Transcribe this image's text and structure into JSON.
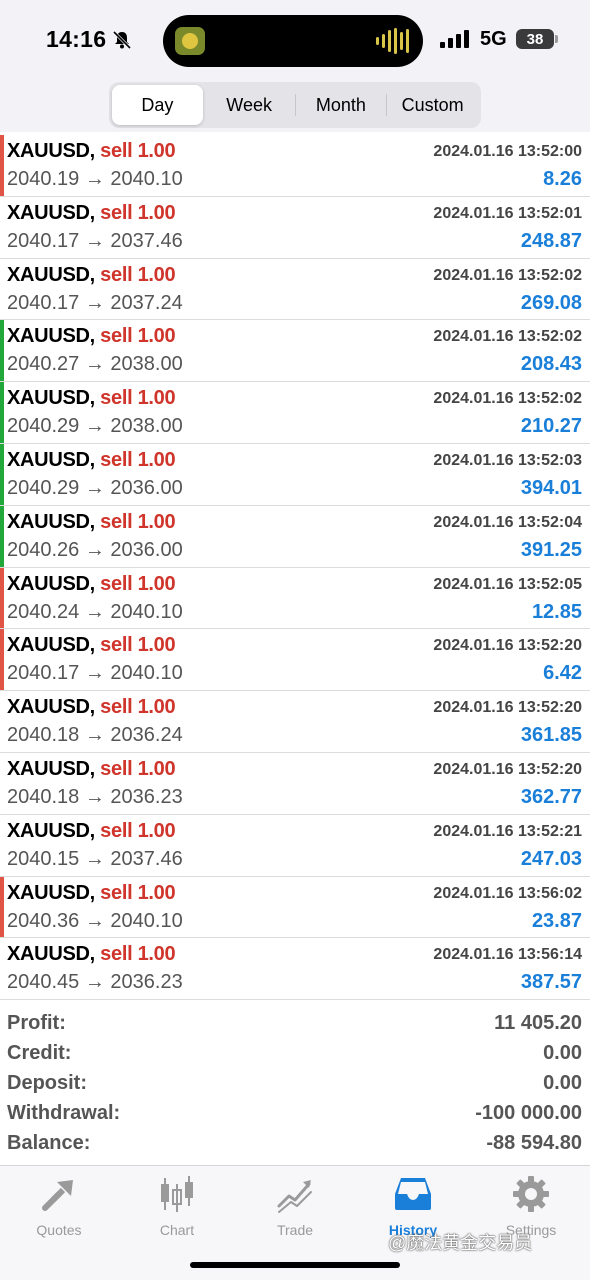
{
  "status_bar": {
    "time": "14:16",
    "network": "5G",
    "battery": "38"
  },
  "periods": {
    "tabs": [
      "Day",
      "Week",
      "Month",
      "Custom"
    ],
    "active": "Day"
  },
  "colors": {
    "sell": "#d0352b",
    "profit": "#1a7fd9",
    "marker_red": "#e05545",
    "marker_green": "#22a83a",
    "active_tab": "#1a7fd9"
  },
  "trades": [
    {
      "symbol": "XAUUSD",
      "side": "sell 1.00",
      "datetime": "2024.01.16 13:52:00",
      "open": "2040.19",
      "close": "2040.10",
      "profit": "8.26",
      "marker": "red"
    },
    {
      "symbol": "XAUUSD",
      "side": "sell 1.00",
      "datetime": "2024.01.16 13:52:01",
      "open": "2040.17",
      "close": "2037.46",
      "profit": "248.87",
      "marker": "none"
    },
    {
      "symbol": "XAUUSD",
      "side": "sell 1.00",
      "datetime": "2024.01.16 13:52:02",
      "open": "2040.17",
      "close": "2037.24",
      "profit": "269.08",
      "marker": "none"
    },
    {
      "symbol": "XAUUSD",
      "side": "sell 1.00",
      "datetime": "2024.01.16 13:52:02",
      "open": "2040.27",
      "close": "2038.00",
      "profit": "208.43",
      "marker": "green"
    },
    {
      "symbol": "XAUUSD",
      "side": "sell 1.00",
      "datetime": "2024.01.16 13:52:02",
      "open": "2040.29",
      "close": "2038.00",
      "profit": "210.27",
      "marker": "green"
    },
    {
      "symbol": "XAUUSD",
      "side": "sell 1.00",
      "datetime": "2024.01.16 13:52:03",
      "open": "2040.29",
      "close": "2036.00",
      "profit": "394.01",
      "marker": "green"
    },
    {
      "symbol": "XAUUSD",
      "side": "sell 1.00",
      "datetime": "2024.01.16 13:52:04",
      "open": "2040.26",
      "close": "2036.00",
      "profit": "391.25",
      "marker": "green"
    },
    {
      "symbol": "XAUUSD",
      "side": "sell 1.00",
      "datetime": "2024.01.16 13:52:05",
      "open": "2040.24",
      "close": "2040.10",
      "profit": "12.85",
      "marker": "red"
    },
    {
      "symbol": "XAUUSD",
      "side": "sell 1.00",
      "datetime": "2024.01.16 13:52:20",
      "open": "2040.17",
      "close": "2040.10",
      "profit": "6.42",
      "marker": "red"
    },
    {
      "symbol": "XAUUSD",
      "side": "sell 1.00",
      "datetime": "2024.01.16 13:52:20",
      "open": "2040.18",
      "close": "2036.24",
      "profit": "361.85",
      "marker": "none"
    },
    {
      "symbol": "XAUUSD",
      "side": "sell 1.00",
      "datetime": "2024.01.16 13:52:20",
      "open": "2040.18",
      "close": "2036.23",
      "profit": "362.77",
      "marker": "none"
    },
    {
      "symbol": "XAUUSD",
      "side": "sell 1.00",
      "datetime": "2024.01.16 13:52:21",
      "open": "2040.15",
      "close": "2037.46",
      "profit": "247.03",
      "marker": "none"
    },
    {
      "symbol": "XAUUSD",
      "side": "sell 1.00",
      "datetime": "2024.01.16 13:56:02",
      "open": "2040.36",
      "close": "2040.10",
      "profit": "23.87",
      "marker": "red"
    },
    {
      "symbol": "XAUUSD",
      "side": "sell 1.00",
      "datetime": "2024.01.16 13:56:14",
      "open": "2040.45",
      "close": "2036.23",
      "profit": "387.57",
      "marker": "none"
    }
  ],
  "arrow": "→",
  "summary": [
    {
      "label": "Profit:",
      "value": "11 405.20"
    },
    {
      "label": "Credit:",
      "value": "0.00"
    },
    {
      "label": "Deposit:",
      "value": "0.00"
    },
    {
      "label": "Withdrawal:",
      "value": "-100 000.00"
    },
    {
      "label": "Balance:",
      "value": "-88 594.80"
    }
  ],
  "tabbar": {
    "tabs": [
      {
        "label": "Quotes",
        "icon": "quotes-icon"
      },
      {
        "label": "Chart",
        "icon": "candlestick-icon"
      },
      {
        "label": "Trade",
        "icon": "trend-icon"
      },
      {
        "label": "History",
        "icon": "inbox-icon"
      },
      {
        "label": "Settings",
        "icon": "gear-icon"
      }
    ],
    "active": "History"
  },
  "watermark": "@魔法黄金交易员"
}
